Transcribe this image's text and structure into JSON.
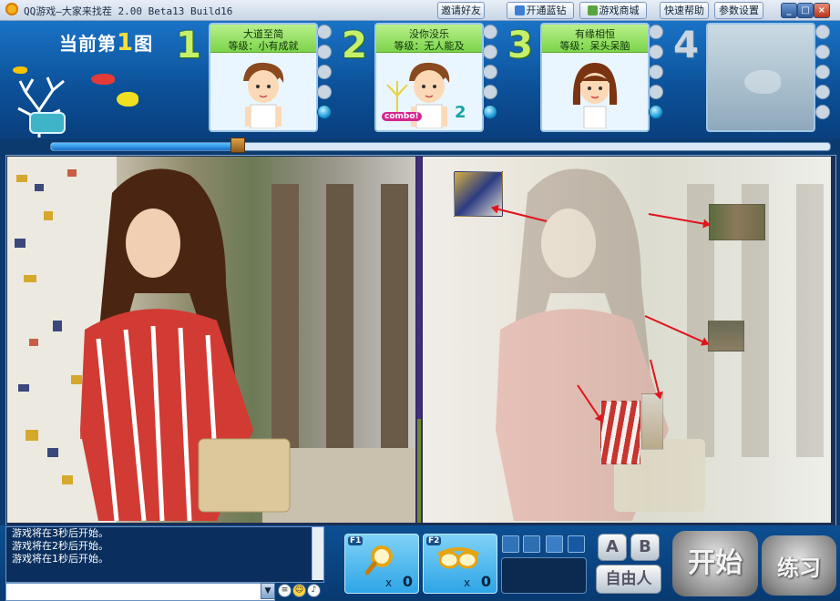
{
  "window": {
    "title": "QQ游戏—大家来找茬  2.00 Beta13 Build16",
    "buttons": {
      "invite": "邀请好友",
      "bluediamond": "开通蓝钻",
      "mall": "游戏商城",
      "help": "快速帮助",
      "settings": "参数设置"
    },
    "controls": {
      "minimize": "_",
      "maximize": "□",
      "close": "×"
    }
  },
  "header": {
    "current_prefix": "当前第",
    "current_number": "1",
    "current_suffix": "图"
  },
  "progress": {
    "fraction": 0.24
  },
  "players": [
    {
      "seat": "1",
      "name": "大道至简",
      "level": "等级：小有成就",
      "gender": "male"
    },
    {
      "seat": "2",
      "name": "没你没乐",
      "level": "等级：无人能及",
      "gender": "male",
      "combo_label": "combo!",
      "combo_count": "2"
    },
    {
      "seat": "3",
      "name": "有缘相恒",
      "level": "等级：呆头呆脑",
      "gender": "female"
    },
    {
      "seat": "4",
      "name": "",
      "level": "",
      "gender": "empty"
    }
  ],
  "chat": {
    "lines": [
      "游戏将在3秒后开始。",
      "游戏将在2秒后开始。",
      "游戏将在1秒后开始。"
    ]
  },
  "tools": [
    {
      "key": "F1",
      "name": "magnifier-icon",
      "x": "x",
      "count": "0"
    },
    {
      "key": "F2",
      "name": "goggles-icon",
      "x": "x",
      "count": "0"
    }
  ],
  "buttons": {
    "a": "A",
    "b": "B",
    "free": "自由人",
    "start": "开始",
    "practice": "练习"
  },
  "colors": {
    "header_blue": "#1a73c6",
    "card_green": "#7cd44b",
    "seat_number": "#c7f06a",
    "arrow_red": "#e0141a",
    "tool_blue": "#2ea5e6"
  }
}
